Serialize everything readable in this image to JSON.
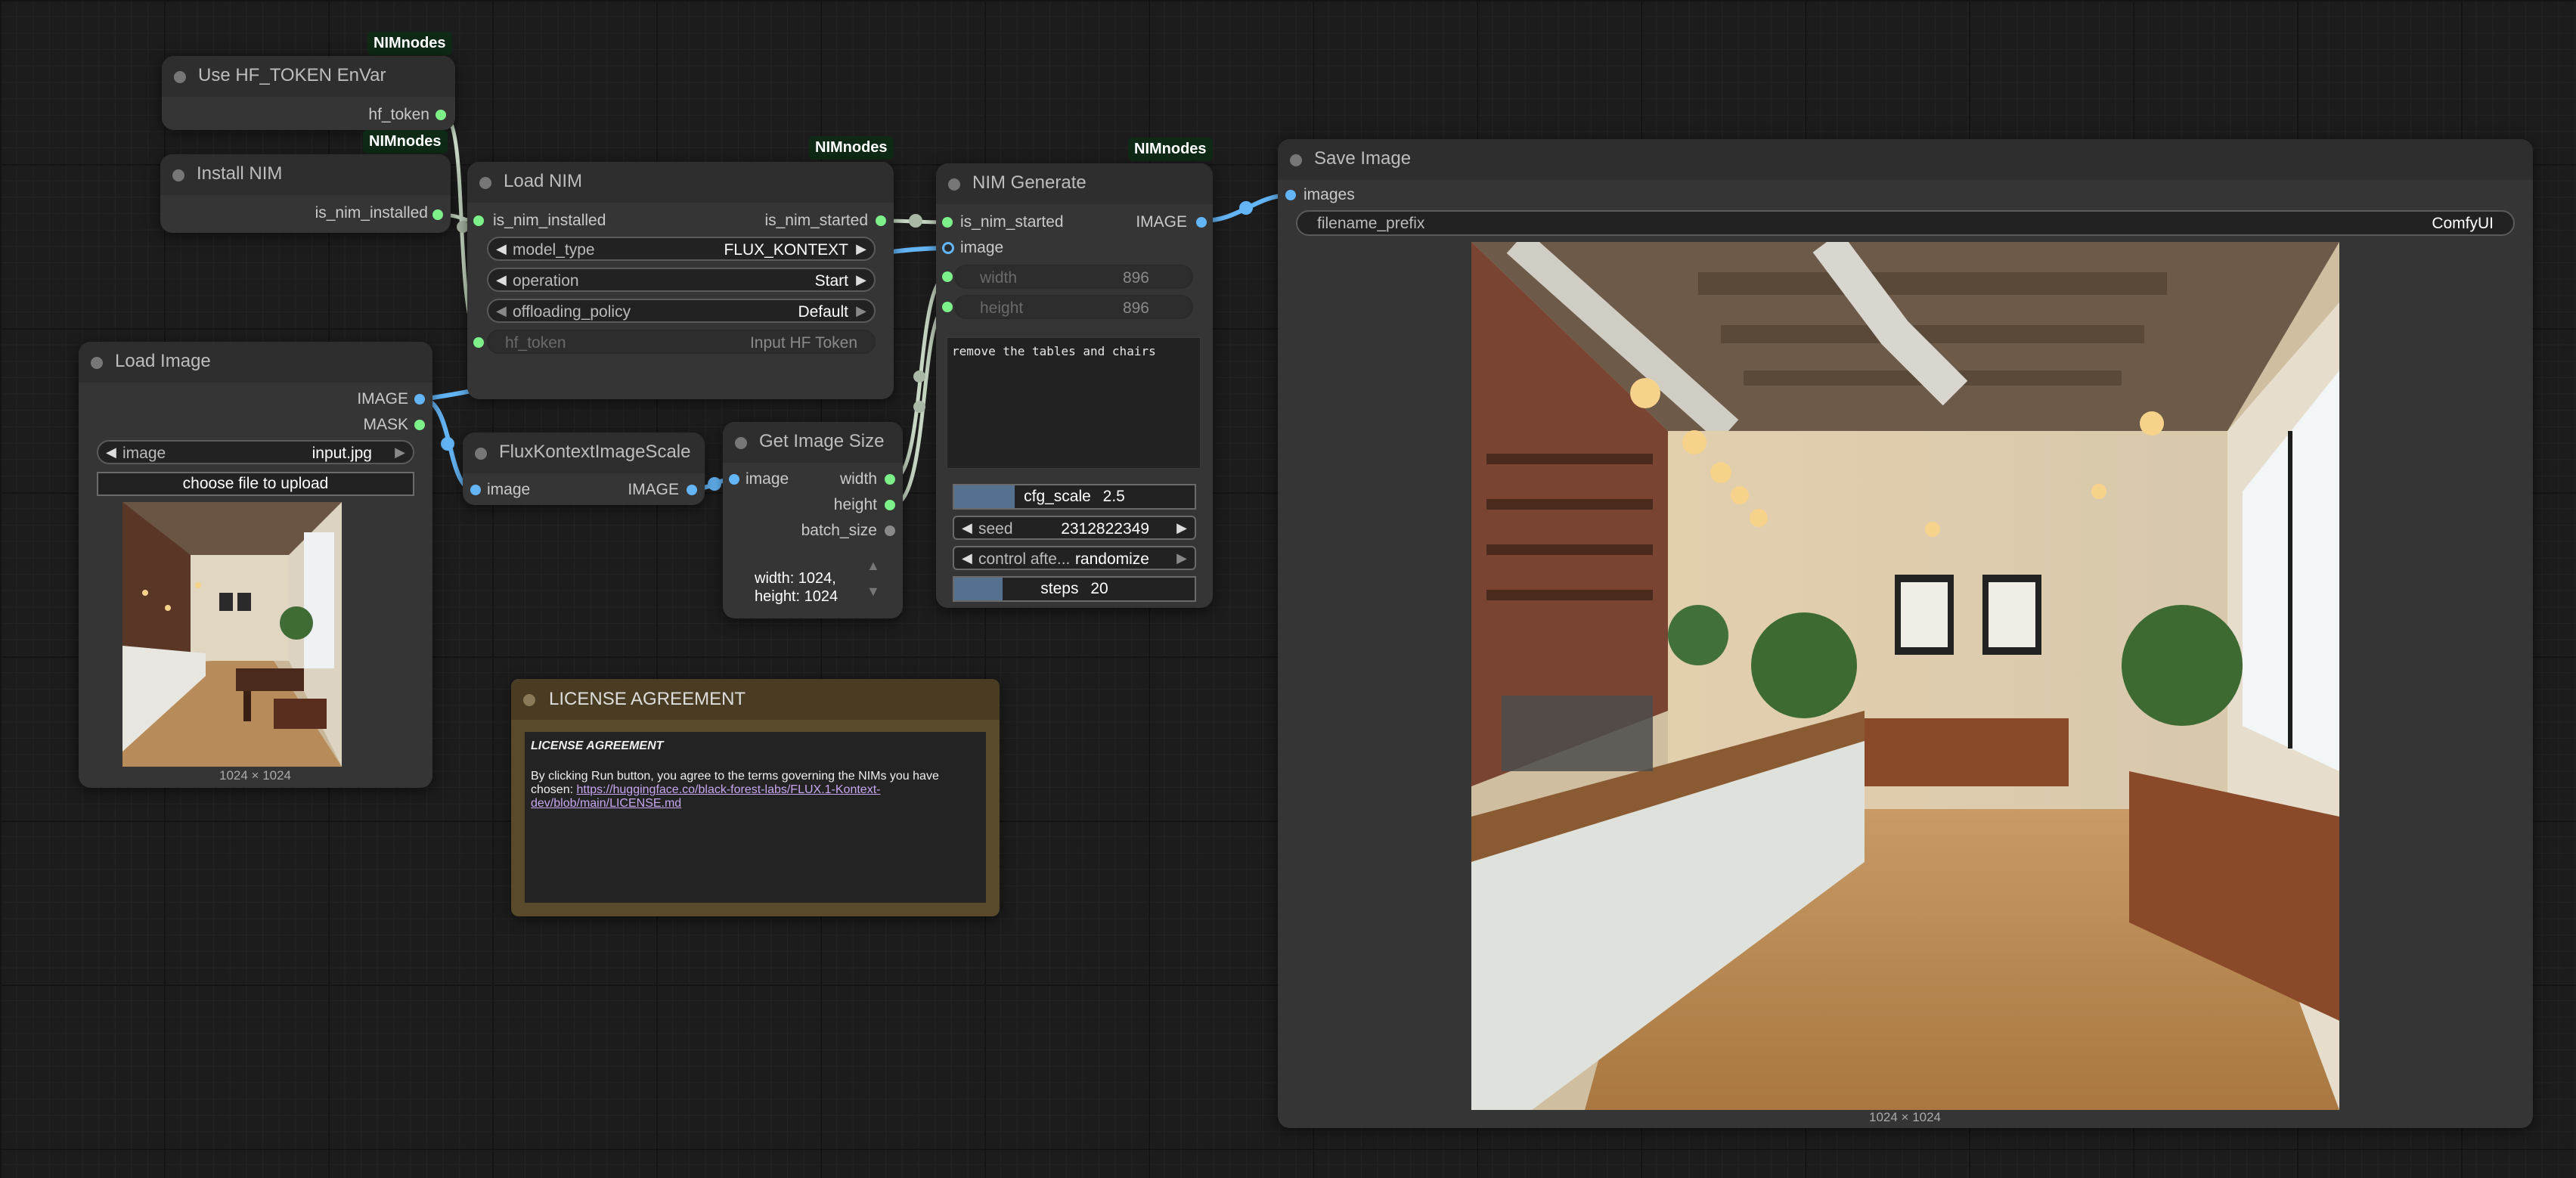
{
  "colors": {
    "canvas_bg": "#1c1c1c",
    "node_bg": "#353535",
    "badge_bg": "#0e2a16",
    "pin_green": "#7df08a",
    "pin_blue": "#64b5f6",
    "license_frame": "#5a4a2c",
    "slider_fill": "#56718f"
  },
  "nodes": {
    "use_hf_token": {
      "title": "Use HF_TOKEN EnVar",
      "badge": "NIMnodes",
      "outputs": [
        "hf_token"
      ]
    },
    "install_nim": {
      "title": "Install NIM",
      "badge": "NIMnodes",
      "outputs": [
        "is_nim_installed"
      ]
    },
    "load_nim": {
      "title": "Load NIM",
      "badge": "NIMnodes",
      "input": "is_nim_installed",
      "output": "is_nim_started",
      "widgets": [
        {
          "label": "model_type",
          "value": "FLUX_KONTEXT"
        },
        {
          "label": "operation",
          "value": "Start"
        },
        {
          "label": "offloading_policy",
          "value": "Default"
        },
        {
          "label": "hf_token",
          "value": "Input HF Token"
        }
      ]
    },
    "load_image": {
      "title": "Load Image",
      "outputs": [
        "IMAGE",
        "MASK"
      ],
      "image_widget": {
        "label": "image",
        "value": "input.jpg"
      },
      "upload_button": "choose file to upload",
      "preview_caption": "1024 × 1024"
    },
    "flux_scale": {
      "title": "FluxKontextImageScale",
      "input": "image",
      "output": "IMAGE"
    },
    "get_image_size": {
      "title": "Get Image Size",
      "input": "image",
      "outputs": [
        "width",
        "height",
        "batch_size"
      ],
      "info_line1": "width: 1024,",
      "info_line2": "height: 1024"
    },
    "nim_generate": {
      "title": "NIM Generate",
      "badge": "NIMnodes",
      "inputs": [
        "is_nim_started",
        "image"
      ],
      "output": "IMAGE",
      "dim_widgets": [
        {
          "label": "width",
          "value": "896"
        },
        {
          "label": "height",
          "value": "896"
        }
      ],
      "prompt": "remove the tables and chairs",
      "cfg_scale": {
        "label": "cfg_scale",
        "value": "2.5",
        "fill": 0.25
      },
      "seed": {
        "label": "seed",
        "value": "2312822349"
      },
      "control": {
        "label": "control afte...",
        "value": "randomize"
      },
      "steps": {
        "label": "steps",
        "value": "20",
        "fill": 0.2
      }
    },
    "save_image": {
      "title": "Save Image",
      "input": "images",
      "widget": {
        "label": "filename_prefix",
        "value": "ComfyUI"
      },
      "preview_caption": "1024 × 1024"
    },
    "license": {
      "title": "LICENSE AGREEMENT",
      "heading": "LICENSE AGREEMENT",
      "text": "By clicking Run button, you agree to the terms governing the NIMs you have chosen: ",
      "link_line1": "https://huggingface.co/black-forest-labs/FLUX.1-Kontext-",
      "link_line2": "dev/blob/main/LICENSE.md"
    }
  }
}
